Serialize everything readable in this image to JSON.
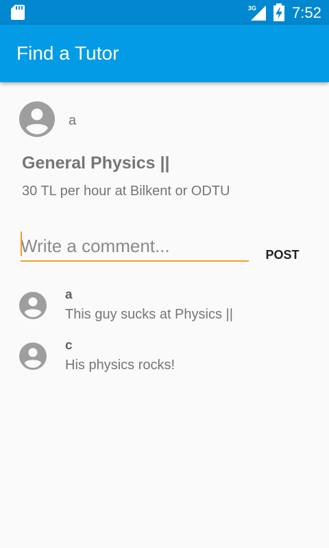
{
  "status_bar": {
    "time": "7:52",
    "network": "3G",
    "icons": [
      "sd-card-icon",
      "signal-icon",
      "battery-icon"
    ]
  },
  "app_bar": {
    "title": "Find a Tutor"
  },
  "post": {
    "author": "a",
    "title": "General Physics ||",
    "description": "30 TL per hour at Bilkent or ODTU"
  },
  "comment_form": {
    "placeholder": "Write a comment...",
    "value": "",
    "post_label": "POST"
  },
  "comments": [
    {
      "author": "a",
      "text": "This guy sucks at Physics ||"
    },
    {
      "author": "c",
      "text": "His physics rocks!"
    }
  ],
  "colors": {
    "status_bar": "#0288d1",
    "app_bar": "#039be5",
    "accent": "#f0a020",
    "background": "#fafafa"
  }
}
